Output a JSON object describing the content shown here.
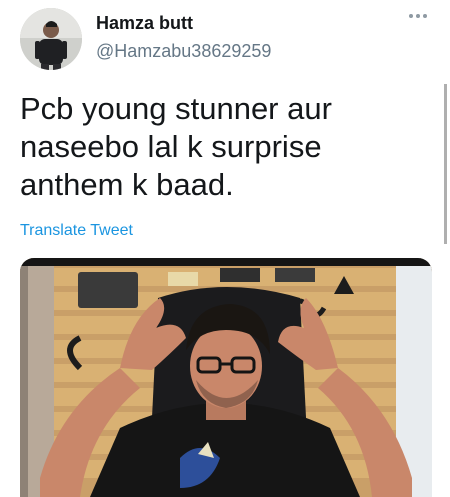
{
  "tweet": {
    "author": {
      "display_name": "Hamza butt",
      "handle": "@Hamzabu38629259"
    },
    "text_lines": [
      "Pcb young stunner aur",
      "naseebo lal k surprise",
      "anthem k baad."
    ],
    "translate_label": "Translate Tweet",
    "more_icon": "more-horizontal-icon",
    "media": {
      "description_icon": "photo",
      "colors": {
        "wall": "#d9b173",
        "shirt": "#151515",
        "skin": "#c9876a",
        "hair": "#1a1612"
      }
    }
  }
}
